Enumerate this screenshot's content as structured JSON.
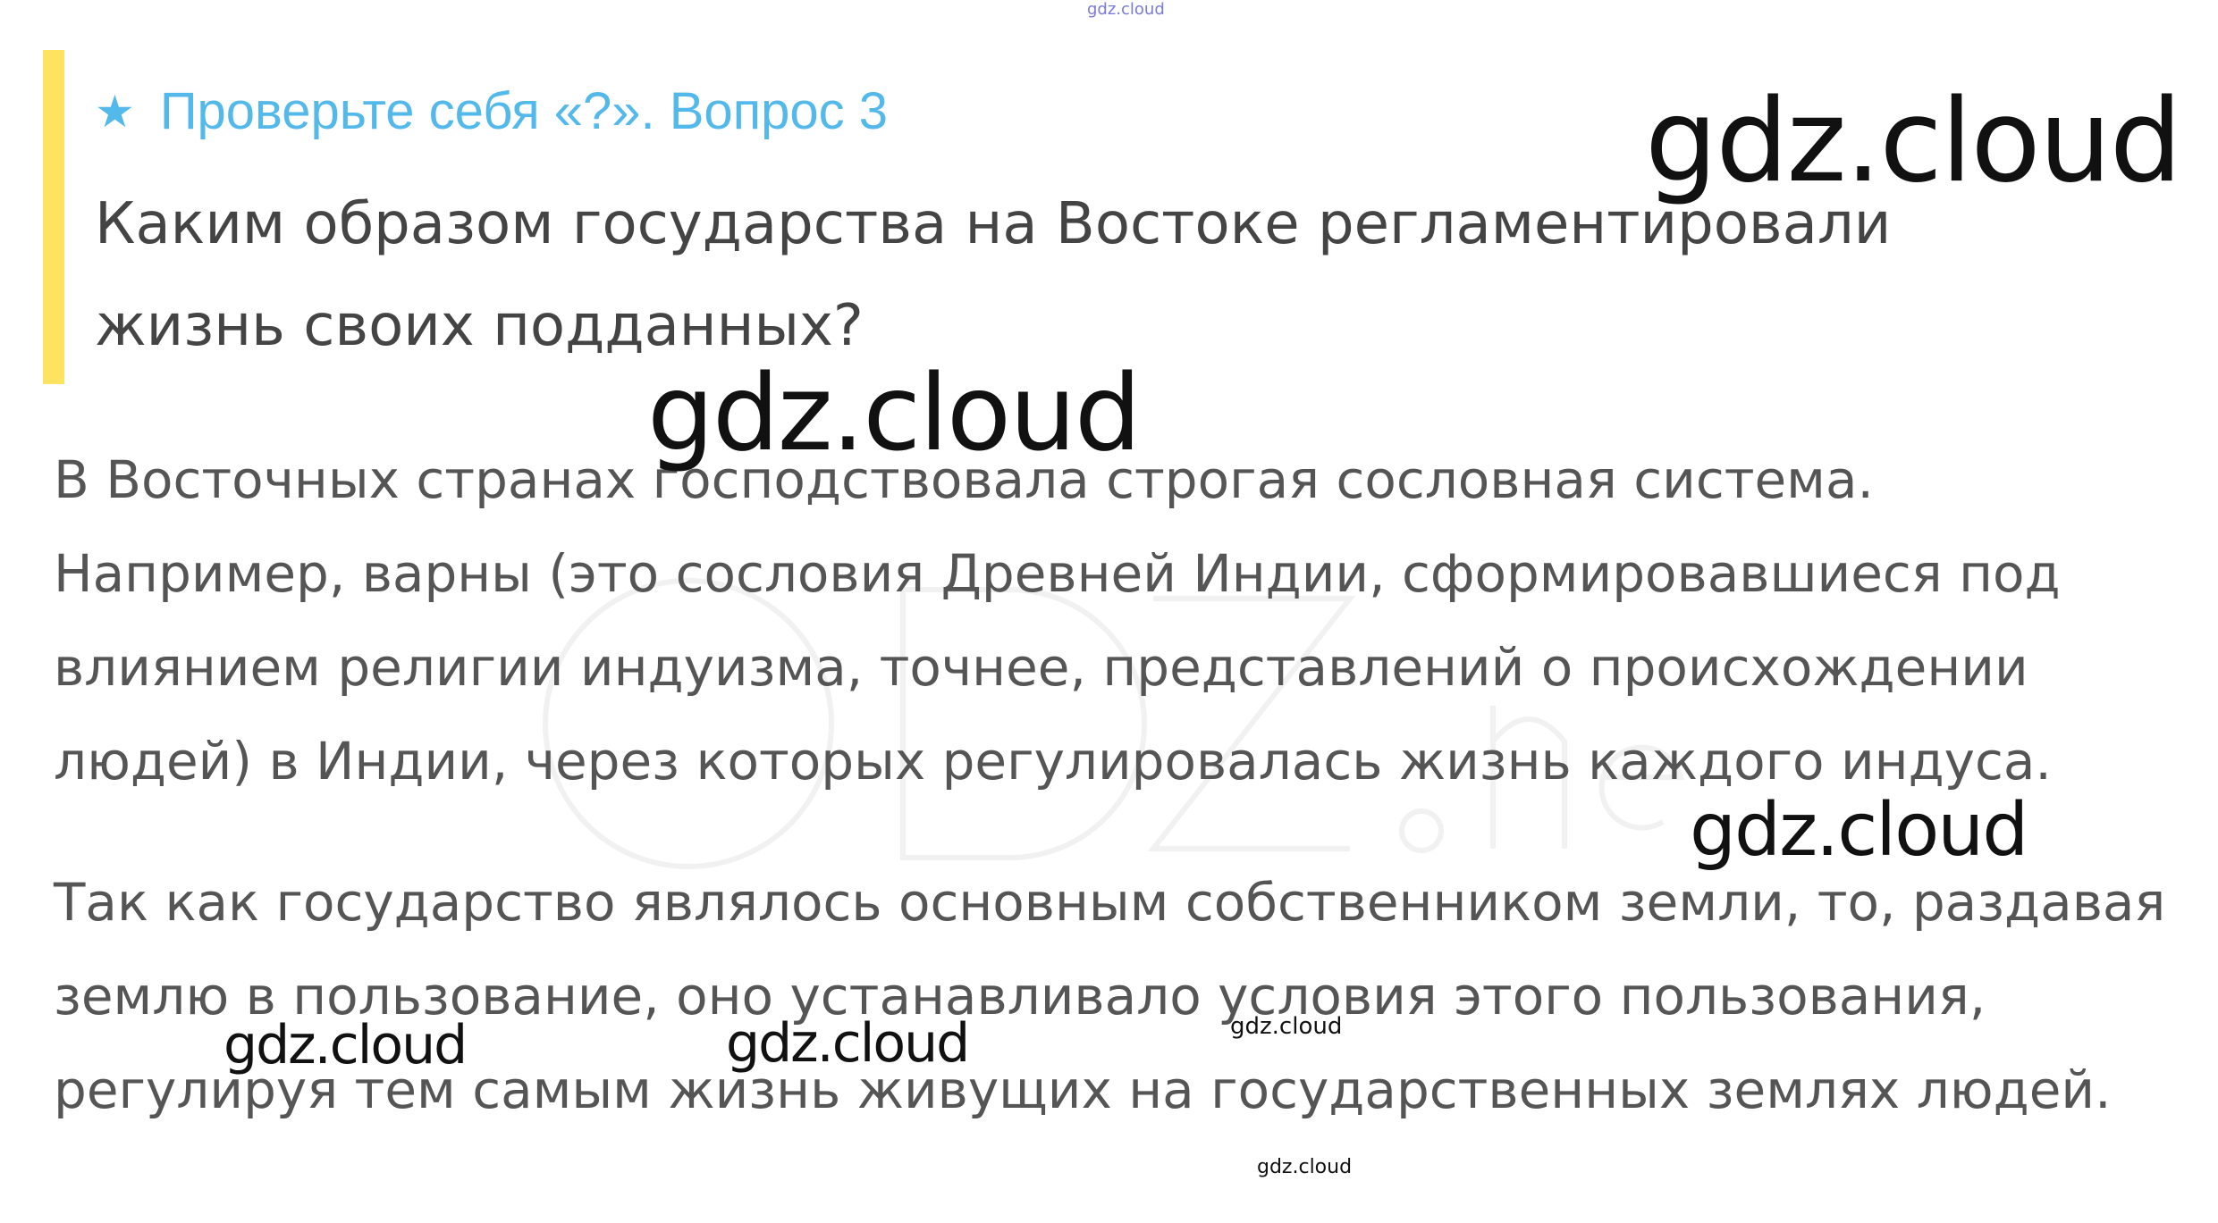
{
  "question": {
    "header": "Проверьте себя «?». Вопрос 3",
    "text": "Каким образом государства на Востоке регламентировали жизнь своих подданных?"
  },
  "answer": {
    "paragraphs": [
      "В Восточных странах господствовала строгая сословная система. Например, варны (это сословия Древней Индии, сформировавшиеся под влиянием религии индуизма, точнее, представлений о происхождении людей) в Индии, через которых регулировалась жизнь каждого индуса.",
      "Так как государство являлось основным собственником земли, то, раздавая землю в пользование, оно устанавливало условия этого пользования, регулируя тем самым жизнь живущих на государственных землях людей."
    ]
  },
  "watermarks": {
    "top": "gdz.cloud",
    "big": "gdz.cloud",
    "mid": "gdz.cloud",
    "right": "gdz.cloud",
    "left1": "gdz.cloud",
    "left2": "gdz.cloud",
    "small1": "gdz.cloud",
    "small2": "gdz.cloud"
  },
  "icons": {
    "header_icon": "star-icon"
  },
  "colors": {
    "accent_bar": "#fde35f",
    "header": "#53b8ea",
    "text": "#444444"
  }
}
